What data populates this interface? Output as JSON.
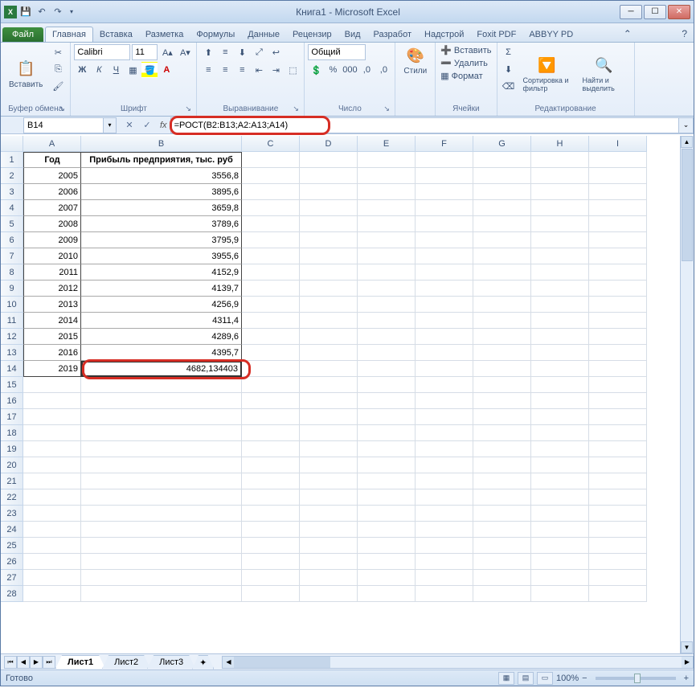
{
  "title": "Книга1 - Microsoft Excel",
  "qat": {
    "save": "💾",
    "undo": "↶",
    "redo": "↷"
  },
  "tabs": {
    "file": "Файл",
    "items": [
      "Главная",
      "Вставка",
      "Разметка",
      "Формулы",
      "Данные",
      "Рецензир",
      "Вид",
      "Разработ",
      "Надстрой",
      "Foxit PDF",
      "ABBYY PD"
    ],
    "active": 0
  },
  "ribbon": {
    "clipboard": {
      "paste": "Вставить",
      "label": "Буфер обмена"
    },
    "font": {
      "name": "Calibri",
      "size": "11",
      "label": "Шрифт"
    },
    "align": {
      "label": "Выравнивание"
    },
    "number": {
      "format": "Общий",
      "label": "Число"
    },
    "styles": {
      "btn": "Стили",
      "label": ""
    },
    "cells": {
      "insert": "Вставить",
      "delete": "Удалить",
      "format": "Формат",
      "label": "Ячейки"
    },
    "editing": {
      "sort": "Сортировка и фильтр",
      "find": "Найти и выделить",
      "label": "Редактирование"
    }
  },
  "namebox": "B14",
  "formula": "=РОСТ(B2:B13;A2:A13;A14)",
  "columns": [
    "A",
    "B",
    "C",
    "D",
    "E",
    "F",
    "G",
    "H",
    "I"
  ],
  "headers": {
    "a": "Год",
    "b": "Прибыль предприятия, тыс. руб"
  },
  "rows": [
    {
      "n": 1
    },
    {
      "n": 2,
      "a": "2005",
      "b": "3556,8"
    },
    {
      "n": 3,
      "a": "2006",
      "b": "3895,6"
    },
    {
      "n": 4,
      "a": "2007",
      "b": "3659,8"
    },
    {
      "n": 5,
      "a": "2008",
      "b": "3789,6"
    },
    {
      "n": 6,
      "a": "2009",
      "b": "3795,9"
    },
    {
      "n": 7,
      "a": "2010",
      "b": "3955,6"
    },
    {
      "n": 8,
      "a": "2011",
      "b": "4152,9"
    },
    {
      "n": 9,
      "a": "2012",
      "b": "4139,7"
    },
    {
      "n": 10,
      "a": "2013",
      "b": "4256,9"
    },
    {
      "n": 11,
      "a": "2014",
      "b": "4311,4"
    },
    {
      "n": 12,
      "a": "2015",
      "b": "4289,6"
    },
    {
      "n": 13,
      "a": "2016",
      "b": "4395,7"
    },
    {
      "n": 14,
      "a": "2019",
      "b": "4682,134403"
    }
  ],
  "sheets": [
    "Лист1",
    "Лист2",
    "Лист3"
  ],
  "status": {
    "ready": "Готово",
    "zoom": "100%"
  }
}
